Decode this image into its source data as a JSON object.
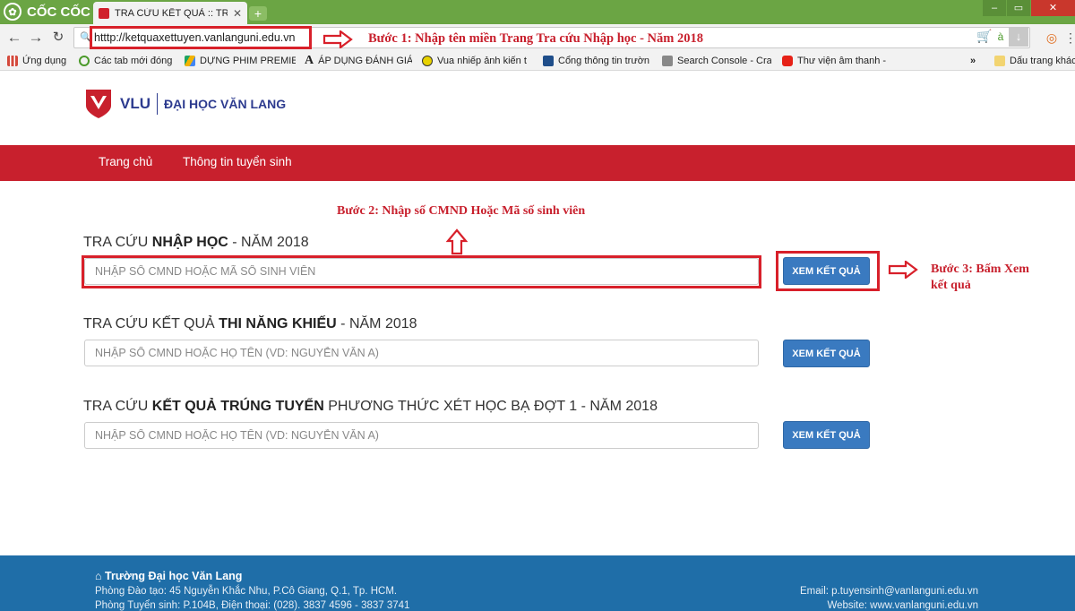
{
  "browser": {
    "brand": "CỐC CỐC",
    "tab_title": "TRA CỨU KẾT QUẢ :: TRƯỜ",
    "url": "htttp://ketquaxettuyen.vanlanguni.edu.vn",
    "bookmarks": [
      {
        "label": "Ứng dụng",
        "icon": "apps-icon",
        "color": "#d4493c"
      },
      {
        "label": "Các tab mới đóng",
        "icon": "history-icon",
        "color": "#4b9a2a"
      },
      {
        "label": "DỰNG PHIM PREMIE",
        "icon": "drive-icon",
        "color": "#f2b300"
      },
      {
        "label": "ÁP DỤNG ĐÁNH GIÁ",
        "icon": "font-icon",
        "color": "#222222"
      },
      {
        "label": "Vua nhiếp ảnh kiến t",
        "icon": "hexagon-icon",
        "color": "#e8d200"
      },
      {
        "label": "Cổng thông tin trườn",
        "icon": "portal-icon",
        "color": "#1f4e8a"
      },
      {
        "label": "Search Console - Cra",
        "icon": "search-console-icon",
        "color": "#888888"
      },
      {
        "label": "Thư viện âm thanh -",
        "icon": "youtube-icon",
        "color": "#e62117"
      },
      {
        "label": "Dấu trang khác",
        "icon": "folder-icon",
        "color": "#f2d471"
      }
    ]
  },
  "annotations": {
    "step1": "Bước 1: Nhập tên miền Trang Tra cứu Nhập học - Năm 2018",
    "step2": "Bước 2: Nhập số CMND Hoặc Mã số sinh viên",
    "step3_line1": "Bước 3: Bấm Xem",
    "step3_line2": "kết quả"
  },
  "site": {
    "logo_short": "VLU",
    "logo_name": "ĐẠI HỌC VĂN LANG",
    "nav": [
      "Trang chủ",
      "Thông tin tuyển sinh"
    ]
  },
  "sections": [
    {
      "title_pre": "TRA CỨU ",
      "title_bold": "NHẬP HỌC",
      "title_post": " - NĂM 2018",
      "placeholder": "NHẬP SỐ CMND HOẶC MÃ SỐ SINH VIÊN",
      "button": "XEM KẾT QUẢ"
    },
    {
      "title_pre": "TRA CỨU KẾT QUẢ ",
      "title_bold": "THI NĂNG KHIẾU",
      "title_post": " - NĂM 2018",
      "placeholder": "NHẬP SỐ CMND HOẶC HỌ TÊN (VD: NGUYỄN VĂN A)",
      "button": "XEM KẾT QUẢ"
    },
    {
      "title_pre": "TRA CỨU ",
      "title_bold": "KẾT QUẢ TRÚNG TUYỂN",
      "title_post": " PHƯƠNG THỨC XÉT HỌC BẠ ĐỢT 1 - NĂM 2018",
      "placeholder": "NHẬP SỐ CMND HOẶC HỌ TÊN (VD: NGUYỄN VĂN A)",
      "button": "XEM KẾT QUẢ"
    }
  ],
  "footer": {
    "school": "Trường Đại học Văn Lang",
    "line1": "Phòng Đào tạo: 45 Nguyễn Khắc Nhu, P.Cô Giang, Q.1, Tp. HCM.",
    "line2": "Phòng Tuyển sinh: P.104B, Điện thoại: (028). 3837 4596 - 3837 3741",
    "email": "Email: p.tuyensinh@vanlanguni.edu.vn",
    "website": "Website: www.vanlanguni.edu.vn"
  },
  "colors": {
    "brand_red": "#c8202d",
    "button_blue": "#3a7ac0",
    "footer_blue": "#1f6ea8",
    "browser_green": "#6ba544"
  }
}
